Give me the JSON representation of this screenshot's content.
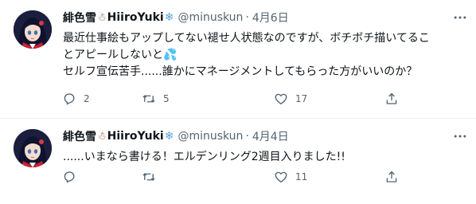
{
  "tweets": [
    {
      "display_name": "緋色雪",
      "name_suffix": "HiiroYuki",
      "handle": "@minuskun",
      "separator": "·",
      "date": "4月6日",
      "lines": [
        "最近仕事絵もアップしてない褪せ人状態なのですが、ボチボチ描いてるこ",
        "とアピールしないと",
        "セルフ宣伝苦手......誰かにマネージメントしてもらった方がいいのか？"
      ],
      "drops": "💦",
      "replies": "2",
      "retweets": "5",
      "likes": "17"
    },
    {
      "display_name": "緋色雪",
      "name_suffix": "HiiroYuki",
      "handle": "@minuskun",
      "separator": "·",
      "date": "4月4日",
      "lines": [
        "......いまなら書ける！エルデンリング2週目入りました!!"
      ],
      "replies": "",
      "retweets": "",
      "likes": "11"
    }
  ],
  "icons": {
    "avatar": "avatar-image",
    "snowman": "snowman-emoji",
    "snowflake": "snowflake-emoji",
    "more": "more-icon",
    "reply": "reply-icon",
    "retweet": "retweet-icon",
    "like": "like-icon",
    "share": "share-icon"
  },
  "colors": {
    "text": "#0f1419",
    "muted": "#536471",
    "divider": "#eff3f4",
    "snowflake": "#58a6d8",
    "drops": "#2f8fe0"
  }
}
